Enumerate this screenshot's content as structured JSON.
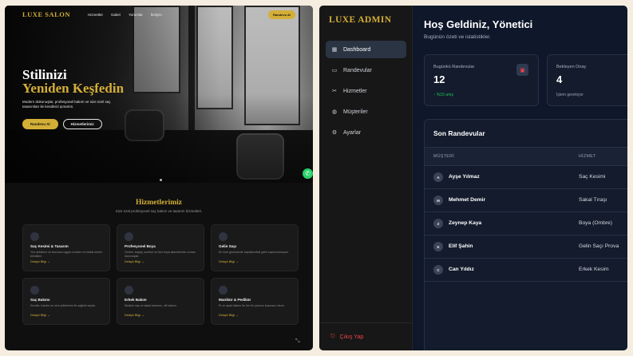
{
  "site": {
    "logo": "LUXE SALON",
    "nav": [
      "Hizmetler",
      "Galeri",
      "Yorumlar",
      "İletişim"
    ],
    "nav_button": "Randevu Al",
    "hero": {
      "title_line1": "Stilinizi",
      "title_line2": "Yeniden Keşfedin",
      "text": "Modern dokunuşlar, profesyonel bakım ve size özel saç tasarımları ile kendinizi şımartın.",
      "primary_button": "Randevu Al",
      "secondary_button": "Hizmetlerimiz"
    },
    "services": {
      "title": "Hizmetlerimiz",
      "subtitle": "Size özel profesyonel saç bakım ve tasarım hizmetleri.",
      "cards": [
        {
          "title": "Saç Kesimi & Tasarım",
          "desc": "Yüz şeklinize ve tarzınıza uygun modern ve klasik kesim teknikleri.",
          "link": "Detaylı Bilgi →"
        },
        {
          "title": "Profesyonel Boya",
          "desc": "Ombre, balyaj, sombre ve tüm boya işlemlerinde uzman dokunuşlar.",
          "link": "Detaylı Bilgi →"
        },
        {
          "title": "Gelin Saçı",
          "desc": "En özel gününüzde hayalinizdeki gelin saçına kavuşun.",
          "link": "Detaylı Bilgi →"
        },
        {
          "title": "Saç Bakımı",
          "desc": "Keratin, botoks ve nem yüklemesi ile sağlıklı saçlar.",
          "link": "Detaylı Bilgi →"
        },
        {
          "title": "Erkek Bakım",
          "desc": "Modern saç ve sakal tasarımı, cilt bakımı.",
          "link": "Detaylı Bilgi →"
        },
        {
          "title": "Manikür & Pedikür",
          "desc": "El ve ayak bakımı ile her bir yanınız kusursuz olsun.",
          "link": "Detaylı Bilgi →"
        }
      ]
    }
  },
  "admin": {
    "logo": "LUXE ADMIN",
    "menu": [
      {
        "label": "Dashboard",
        "icon": "grid-icon"
      },
      {
        "label": "Randevular",
        "icon": "calendar-icon"
      },
      {
        "label": "Hizmetler",
        "icon": "scissors-icon"
      },
      {
        "label": "Müşteriler",
        "icon": "users-icon"
      },
      {
        "label": "Ayarlar",
        "icon": "gear-icon"
      }
    ],
    "logout": "Çıkış Yap",
    "title": "Hoş Geldiniz, Yönetici",
    "subtitle": "Bugünün özeti ve istatistikler.",
    "stats": [
      {
        "label": "Bugünkü Randevular",
        "value": "12",
        "note": "↑ %15 artış"
      },
      {
        "label": "Bekleyen Onay",
        "value": "4",
        "note": "İşlem gerekiyor"
      }
    ],
    "recent": {
      "title": "Son Randevular",
      "columns": [
        "MÜŞTERİ",
        "HİZMET"
      ],
      "rows": [
        {
          "initial": "A",
          "name": "Ayşe Yılmaz",
          "service": "Saç Kesimi"
        },
        {
          "initial": "M",
          "name": "Mehmet Demir",
          "service": "Sakal Tıraşı"
        },
        {
          "initial": "Z",
          "name": "Zeynep Kaya",
          "service": "Boya (Ombre)"
        },
        {
          "initial": "E",
          "name": "Elif Şahin",
          "service": "Gelin Saçı Prova"
        },
        {
          "initial": "C",
          "name": "Can Yıldız",
          "service": "Erkek Kesim"
        }
      ]
    }
  },
  "colors": {
    "gold": "#d4af37",
    "green": "#22c55e",
    "red": "#ef4444",
    "navy": "#0f172a"
  }
}
